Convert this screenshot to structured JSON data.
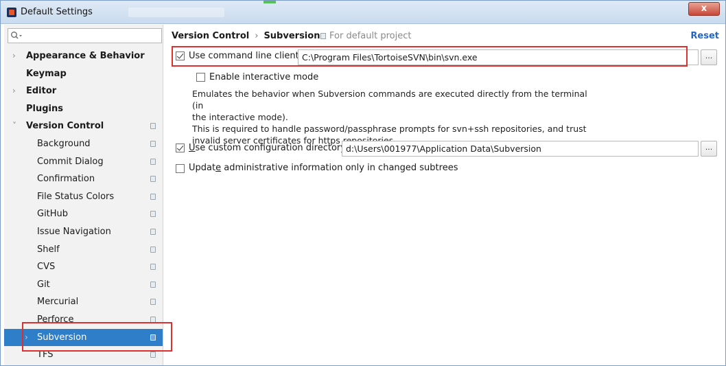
{
  "window": {
    "title": "Default Settings",
    "close_label": "x"
  },
  "sidebar": {
    "search_placeholder": "",
    "items": [
      {
        "label": "Appearance & Behavior",
        "level": 0,
        "expandable": true,
        "expanded": false,
        "bold": true
      },
      {
        "label": "Keymap",
        "level": 0,
        "expandable": false,
        "bold": true
      },
      {
        "label": "Editor",
        "level": 0,
        "expandable": true,
        "expanded": false,
        "bold": true
      },
      {
        "label": "Plugins",
        "level": 0,
        "expandable": false,
        "bold": true
      },
      {
        "label": "Version Control",
        "level": 0,
        "expandable": true,
        "expanded": true,
        "bold": true
      },
      {
        "label": "Background",
        "level": 1
      },
      {
        "label": "Commit Dialog",
        "level": 1
      },
      {
        "label": "Confirmation",
        "level": 1
      },
      {
        "label": "File Status Colors",
        "level": 1
      },
      {
        "label": "GitHub",
        "level": 1
      },
      {
        "label": "Issue Navigation",
        "level": 1
      },
      {
        "label": "Shelf",
        "level": 1
      },
      {
        "label": "CVS",
        "level": 1
      },
      {
        "label": "Git",
        "level": 1
      },
      {
        "label": "Mercurial",
        "level": 1
      },
      {
        "label": "Perforce",
        "level": 1
      },
      {
        "label": "Subversion",
        "level": 1,
        "selected": true
      },
      {
        "label": "TFS",
        "level": 1
      }
    ],
    "selected_color": "#2f7ec9"
  },
  "header": {
    "breadcrumb_parent": "Version Control",
    "breadcrumb_separator": "›",
    "breadcrumb_current": "Subversion",
    "scope_label": "For default project",
    "reset_label": "Reset"
  },
  "settings": {
    "use_cmd_client": {
      "label": "Use command line client:",
      "checked": true,
      "value": "C:\\Program Files\\TortoiseSVN\\bin\\svn.exe",
      "browse_label": "..."
    },
    "interactive_mode": {
      "label": "Enable interactive mode",
      "checked": false
    },
    "description": [
      "Emulates the behavior when Subversion commands are executed directly from the terminal (in",
      "the interactive mode).",
      "This is required to handle password/passphrase prompts for svn+ssh repositories, and trust",
      "invalid server certificates for https repositories."
    ],
    "custom_config_dir": {
      "label_prefix": "",
      "label_mnemonic": "U",
      "label_rest": "se custom configuration directory:",
      "checked": true,
      "value": "d:\\Users\\001977\\Application Data\\Subversion",
      "browse_label": "..."
    },
    "update_admin_info": {
      "label_prefix": "Updat",
      "label_mnemonic": "e",
      "label_rest": " administrative information only in changed subtrees",
      "checked": false
    }
  },
  "colors": {
    "highlight_box": "#e02f2f",
    "link": "#2566c4"
  }
}
